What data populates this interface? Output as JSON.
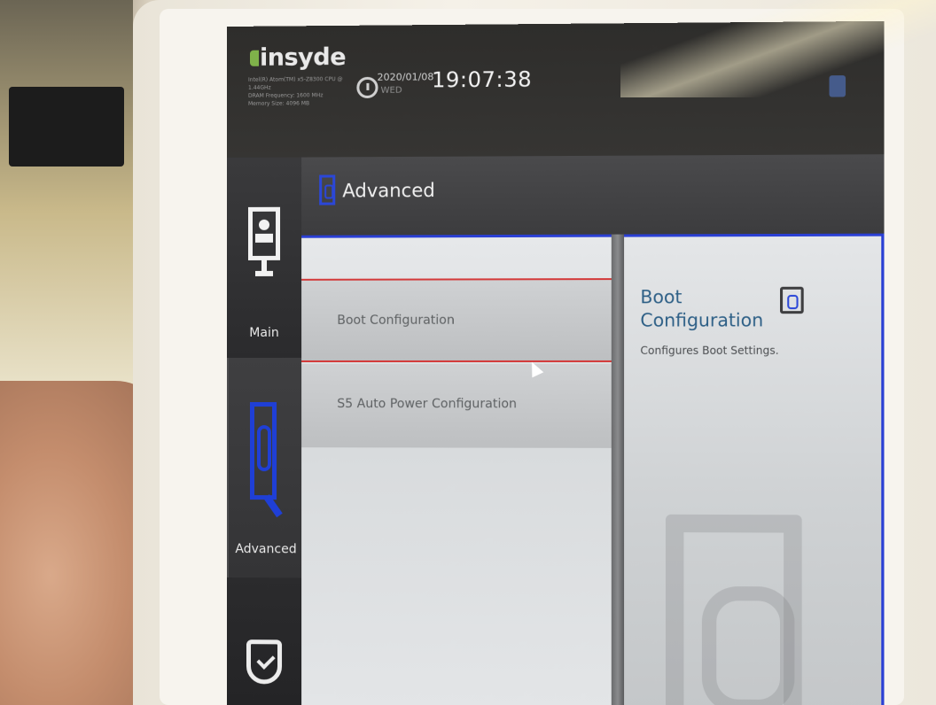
{
  "header": {
    "brand": "insyde",
    "system_info": [
      "Intel(R) Atom(TM) x5-Z8300 CPU @",
      "1.44GHz",
      "DRAM Frequency: 1600 MHz",
      "Memory Size: 4096 MB"
    ],
    "date": "2020/01/08",
    "weekday": "WED",
    "time": "19:07:38"
  },
  "nav": {
    "items": [
      {
        "label": "Main",
        "icon": "monitor-user-icon"
      },
      {
        "label": "Advanced",
        "icon": "advanced-icon",
        "selected": true
      },
      {
        "label": "",
        "icon": "shield-icon"
      }
    ]
  },
  "page": {
    "title": "Advanced"
  },
  "menu": {
    "items": [
      {
        "label": "Boot Configuration",
        "selected": true
      },
      {
        "label": "S5 Auto Power Configuration"
      }
    ]
  },
  "help": {
    "title": "Boot Configuration",
    "description": "Configures Boot Settings."
  },
  "colors": {
    "accent": "#2a3fd4",
    "selection": "#d33a3a",
    "help_title": "#2d5f86"
  }
}
